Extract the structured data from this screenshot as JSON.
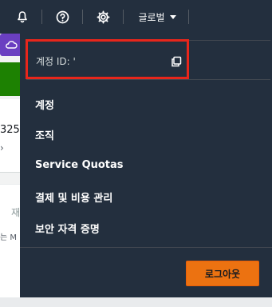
{
  "topbar": {
    "region_label": "글로벌",
    "icons": {
      "notifications": "bell-icon",
      "help": "help-icon",
      "settings": "gear-icon",
      "region_caret": "caret-down-icon"
    }
  },
  "background": {
    "number_fragment": "325",
    "text_fragment_1": "재",
    "text_fragment_2": "는 M"
  },
  "account_menu": {
    "account_id_label": "계정 ID: '",
    "items": [
      {
        "label": "계정"
      },
      {
        "label": "조직"
      },
      {
        "label": "Service Quotas"
      },
      {
        "label": "결제 및 비용 관리"
      },
      {
        "label": "보안 자격 증명"
      }
    ],
    "logout_label": "로그아웃"
  },
  "colors": {
    "nav_background": "#232f3e",
    "highlight_box": "#e8261b",
    "logout_button": "#ec7211"
  }
}
